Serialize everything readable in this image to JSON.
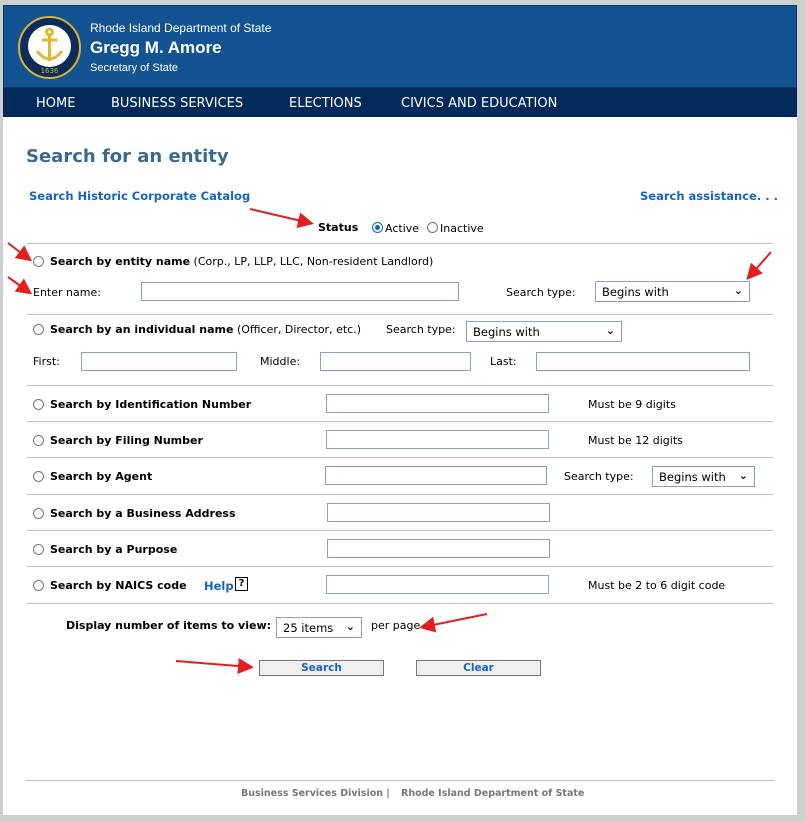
{
  "header": {
    "department": "Rhode Island Department of State",
    "name": "Gregg M. Amore",
    "role": "Secretary of State",
    "seal_year": "1636"
  },
  "nav": [
    "HOME",
    "BUSINESS SERVICES",
    "ELECTIONS",
    "CIVICS AND EDUCATION"
  ],
  "page_title": "Search for an entity",
  "historic_link": "Search Historic Corporate Catalog",
  "assistance_link": "Search assistance. . .",
  "status": {
    "label": "Status",
    "options": [
      "Active",
      "Inactive"
    ],
    "selected": "Active"
  },
  "entity": {
    "label": "Search by entity name",
    "hint": "(Corp., LP, LLP, LLC, Non-resident Landlord)",
    "name_label": "Enter name:",
    "name_value": "",
    "type_label": "Search type:",
    "type_value": "Begins with"
  },
  "individual": {
    "label": "Search by an individual name",
    "hint": "(Officer, Director, etc.)",
    "type_label": "Search type:",
    "type_value": "Begins with",
    "first": "First:",
    "middle": "Middle:",
    "last": "Last:"
  },
  "id": {
    "label": "Search by Identification Number",
    "note": "Must be 9 digits"
  },
  "filing": {
    "label": "Search by Filing Number",
    "note": "Must be 12 digits"
  },
  "agent": {
    "label": "Search by Agent",
    "type_label": "Search type:",
    "type_value": "Begins with"
  },
  "address": {
    "label": "Search by a Business Address"
  },
  "purpose": {
    "label": "Search by a Purpose"
  },
  "naics": {
    "label": "Search by NAICS code",
    "help": "Help",
    "help_icon": "?",
    "note": "Must be 2 to 6 digit code"
  },
  "display": {
    "label": "Display number of items to view:",
    "value": "25 items",
    "suffix": "per page"
  },
  "buttons": {
    "search": "Search",
    "clear": "Clear"
  },
  "footer": {
    "left": "Business Services Division |",
    "right": "Rhode Island Department of State"
  },
  "colors": {
    "header": "#135392",
    "nav": "#032a5c",
    "link": "#1565c0",
    "title": "#3b6a8f",
    "annotation_arrow": "#e02020"
  }
}
